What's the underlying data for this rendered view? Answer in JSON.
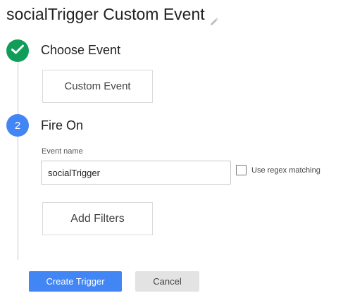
{
  "header": {
    "title": "socialTrigger Custom Event",
    "edit_icon": "pencil-icon"
  },
  "steps": [
    {
      "state": "complete",
      "icon": "checkmark-icon",
      "color": "#0f9d58",
      "label": "Choose Event",
      "selection_label": "Custom Event"
    },
    {
      "state": "active",
      "number": "2",
      "color": "#4285f4",
      "label": "Fire On"
    }
  ],
  "fire_on": {
    "event_name_label": "Event name",
    "event_name_value": "socialTrigger",
    "regex_checkbox_label": "Use regex matching",
    "regex_checked": false,
    "add_filters_label": "Add Filters"
  },
  "actions": {
    "create_label": "Create Trigger",
    "create_color": "#4285f4",
    "cancel_label": "Cancel"
  }
}
